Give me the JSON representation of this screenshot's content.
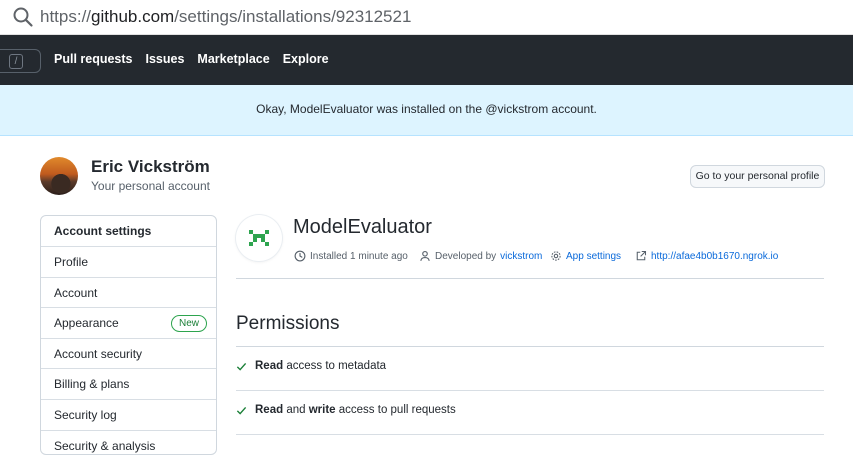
{
  "browser": {
    "url_prefix": "https://",
    "url_host": "github.com",
    "url_path": "/settings/installations/92312521"
  },
  "header": {
    "search_shortcut": "/",
    "nav": [
      "Pull requests",
      "Issues",
      "Marketplace",
      "Explore"
    ]
  },
  "flash": {
    "message": "Okay, ModelEvaluator was installed on the @vickstrom account."
  },
  "user": {
    "name": "Eric Vickström",
    "subtitle": "Your personal account",
    "profile_button": "Go to your personal profile"
  },
  "sidebar": {
    "heading": "Account settings",
    "items": [
      {
        "label": "Profile"
      },
      {
        "label": "Account"
      },
      {
        "label": "Appearance",
        "badge": "New"
      },
      {
        "label": "Account security"
      },
      {
        "label": "Billing & plans"
      },
      {
        "label": "Security log"
      },
      {
        "label": "Security & analysis"
      }
    ]
  },
  "app": {
    "name": "ModelEvaluator",
    "installed": "Installed 1 minute ago",
    "developed_by_label": "Developed by",
    "developer": "vickstrom",
    "settings_link": "App settings",
    "url": "http://afae4b0b1670.ngrok.io"
  },
  "permissions": {
    "title": "Permissions",
    "rows": [
      {
        "level": "Read",
        "joiner": "",
        "level2": "",
        "text": "access to metadata"
      },
      {
        "level": "Read",
        "joiner": "and",
        "level2": "write",
        "text": "access to pull requests"
      }
    ]
  },
  "colors": {
    "header_bg": "#24292f",
    "flash_bg": "#ddf4ff",
    "link": "#0969da",
    "success": "#1a7f37"
  }
}
